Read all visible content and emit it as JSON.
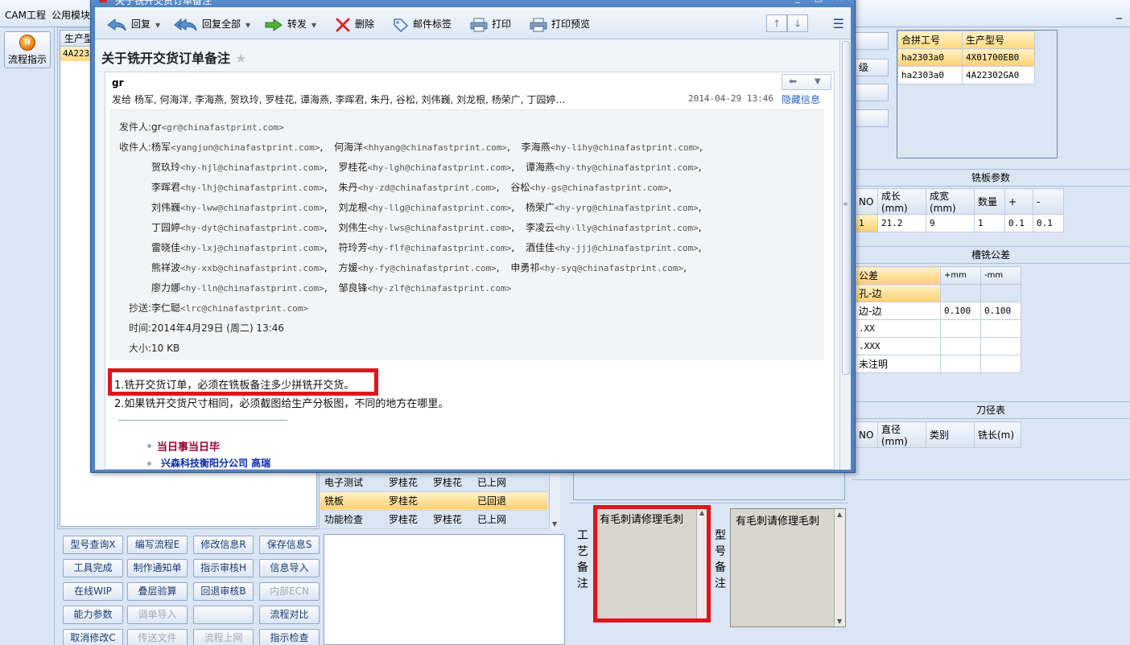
{
  "app": {
    "menu": [
      "CAM工程",
      "公用模块"
    ],
    "flow_button": "流程指示",
    "product_list_header": "生产型",
    "product_list_row": "4A223",
    "steps": [
      {
        "name": "电子测试",
        "person1": "罗桂花",
        "person2": "罗桂花",
        "status": "已上网"
      },
      {
        "name": "铣板",
        "person1": "罗桂花",
        "person2": "",
        "status": "已回退"
      },
      {
        "name": "功能检查",
        "person1": "罗桂花",
        "person2": "罗桂花",
        "status": "已上网"
      }
    ],
    "buttons": [
      [
        "型号查询X",
        "编写流程E",
        "修改信息R",
        "保存信息S"
      ],
      [
        "工具完成",
        "制作通知单",
        "指示审核H",
        "信息导入"
      ],
      [
        "在线WIP",
        "叠层验算",
        "回退审核B",
        "内部ECN"
      ],
      [
        "能力参数",
        "调单导入",
        "",
        "流程对比"
      ],
      [
        "取消修改C",
        "传送文件",
        "流程上网",
        "指示检查"
      ]
    ],
    "disabled_buttons": [
      "内部ECN",
      "调单导入",
      "",
      "传送文件",
      "流程上网"
    ],
    "process_remark_label": "工艺备注",
    "process_remark": "有毛刺请修理毛刺",
    "model_remark_label": "型号备注",
    "model_remark": "有毛刺请修理毛刺"
  },
  "right": {
    "side_buttons": [
      "",
      "级",
      "",
      ""
    ],
    "pair_headers": [
      "合拼工号",
      "生产型号"
    ],
    "pair_rows": [
      [
        "ha2303a0",
        "4X01700EB0"
      ],
      [
        "ha2303a0",
        "4A22302GA0"
      ]
    ],
    "mill_title": "铣板参数",
    "mill_headers": [
      "NO",
      "成长(mm)",
      "成宽(mm)",
      "数量",
      "+",
      "-"
    ],
    "mill_row": [
      "1",
      "21.2",
      "9",
      "1",
      "0.1",
      "0.1"
    ],
    "slot_title": "槽铣公差",
    "slot_headers": [
      "公差",
      "+mm",
      "-mm"
    ],
    "slot_rows": [
      [
        "孔-边",
        "",
        ""
      ],
      [
        "边-边",
        "0.100",
        "0.100"
      ],
      [
        ".XX",
        "",
        ""
      ],
      [
        ".XXX",
        "",
        ""
      ],
      [
        "未注明",
        "",
        ""
      ]
    ],
    "tool_title": "刀径表",
    "tool_headers": [
      "NO",
      "直径(mm)",
      "类别",
      "铣长(m)"
    ]
  },
  "mail": {
    "window_title": "关于铣开交货订单备注",
    "toolbar": {
      "reply": "回复",
      "reply_all": "回复全部",
      "forward": "转发",
      "delete": "删除",
      "tag": "邮件标签",
      "print": "打印",
      "print_preview": "打印预览"
    },
    "subject": "关于铣开交货订单备注",
    "from_short": "gr",
    "to_short": "发给 杨军, 何海洋, 李海燕, 贺玖玲, 罗桂花, 谭海燕, 李晖君, 朱丹, 谷松, 刘伟巍, 刘龙根, 杨荣广, 丁园婷…",
    "date": "2014-04-29 13:46",
    "hide_info": "隐藏信息",
    "labels": {
      "from": "发件人:",
      "to": "收件人:",
      "cc": "抄送:",
      "time": "时间:",
      "size": "大小:"
    },
    "from_name": "gr",
    "from_addr": "<gr@chinafastprint.com>",
    "recipients": [
      [
        [
          "杨军",
          "<yangjun@chinafastprint.com>"
        ],
        [
          "何海洋",
          "<hhyang@chinafastprint.com>"
        ],
        [
          "李海燕",
          "<hy-lihy@chinafastprint.com>"
        ]
      ],
      [
        [
          "贺玖玲",
          "<hy-hjl@chinafastprint.com>"
        ],
        [
          "罗桂花",
          "<hy-lgh@chinafastprint.com>"
        ],
        [
          "谭海燕",
          "<hy-thy@chinafastprint.com>"
        ]
      ],
      [
        [
          "李晖君",
          "<hy-lhj@chinafastprint.com>"
        ],
        [
          "朱丹",
          "<hy-zd@chinafastprint.com>"
        ],
        [
          "谷松",
          "<hy-gs@chinafastprint.com>"
        ]
      ],
      [
        [
          "刘伟巍",
          "<hy-lww@chinafastprint.com>"
        ],
        [
          "刘龙根",
          "<hy-llg@chinafastprint.com>"
        ],
        [
          "杨荣广",
          "<hy-yrg@chinafastprint.com>"
        ]
      ],
      [
        [
          "丁园婷",
          "<hy-dyt@chinafastprint.com>"
        ],
        [
          "刘伟生",
          "<hy-lws@chinafastprint.com>"
        ],
        [
          "李凌云",
          "<hy-lly@chinafastprint.com>"
        ]
      ],
      [
        [
          "雷晓佳",
          "<hy-lxj@chinafastprint.com>"
        ],
        [
          "符玲芳",
          "<hy-flf@chinafastprint.com>"
        ],
        [
          "酒佳佳",
          "<hy-jjj@chinafastprint.com>"
        ]
      ],
      [
        [
          "熊祥波",
          "<hy-xxb@chinafastprint.com>"
        ],
        [
          "方媛",
          "<hy-fy@chinafastprint.com>"
        ],
        [
          "申勇祁",
          "<hy-syq@chinafastprint.com>"
        ]
      ],
      [
        [
          "廖力娜",
          "<hy-lln@chinafastprint.com>"
        ],
        [
          "邹良锋",
          "<hy-zlf@chinafastprint.com>"
        ]
      ]
    ],
    "cc_name": "李仁聪",
    "cc_addr": "<lrc@chinafastprint.com>",
    "time": "2014年4月29日 (周二) 13:46",
    "size": "10 KB",
    "body": [
      "1.铣开交货订单，必须在铣板备注多少拼铣开交货。",
      "2.如果铣开交货尺寸相同，必须截图给生产分板图，不同的地方在哪里。"
    ],
    "signature": [
      "当日事当日毕",
      "兴森科技衡阳分公司  高瑞"
    ]
  },
  "colors": {
    "highlight_red": "#e0141e",
    "selected_row": "#ffcf6e",
    "link": "#2a64b8",
    "signature_red": "#a0003a",
    "signature_blue": "#0a2aa8"
  }
}
